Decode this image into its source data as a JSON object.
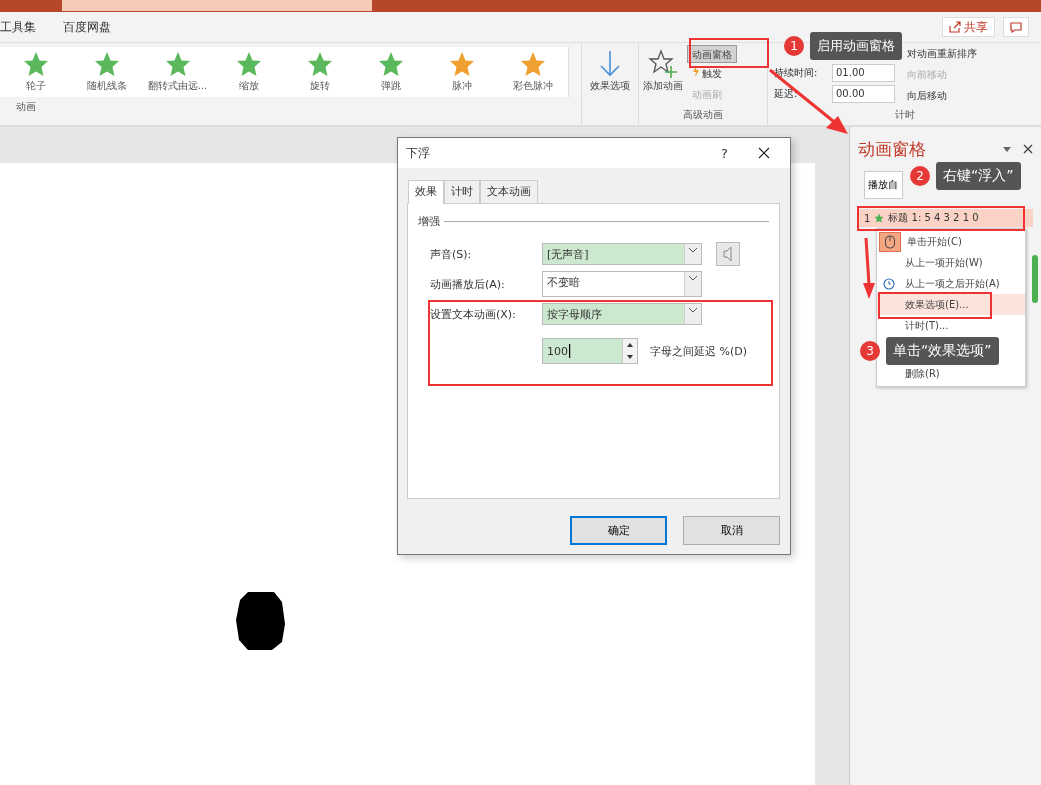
{
  "menu_tabs": [
    {
      "label": "工具集",
      "selected": false
    },
    {
      "label": "百度网盘",
      "selected": false
    }
  ],
  "share_button": "共享",
  "ribbon": {
    "gallery": [
      {
        "label": "轮子",
        "color": "#5cb85c"
      },
      {
        "label": "随机线条",
        "color": "#5cb85c"
      },
      {
        "label": "翻转式由远...",
        "color": "#5cb85c"
      },
      {
        "label": "缩放",
        "color": "#5cb85c"
      },
      {
        "label": "旋转",
        "color": "#5cb85c"
      },
      {
        "label": "弹跳",
        "color": "#5cb85c"
      },
      {
        "label": "脉冲",
        "color": "#f0a030"
      },
      {
        "label": "彩色脉冲",
        "color": "#f0a030"
      }
    ],
    "animation_group": "动画",
    "effect_options": "效果选项",
    "add_animation": "添加动画",
    "animation_pane": {
      "label": "动画窗格",
      "selected": true
    },
    "trigger": "触发",
    "painter": {
      "label": "动画刷",
      "disabled": true
    },
    "advanced_group": "高级动画",
    "duration_label": "持续时间:",
    "duration": "01.00",
    "delay_label": "延迟:",
    "delay": "00.00",
    "reorder": "对动画重新排序",
    "move_earlier": {
      "label": "向前移动",
      "disabled": true
    },
    "move_later": {
      "label": "向后移动",
      "disabled": false
    },
    "timing_group": "计时"
  },
  "pane": {
    "title": "动画窗格",
    "play_button": "播放自",
    "item": {
      "number": "1",
      "label": "标题 1: 5 4 3 2 1 0",
      "selected": true
    },
    "menu": [
      {
        "label": "单击开始(C)",
        "kind": "mouse",
        "checked": true,
        "selected": false
      },
      {
        "label": "从上一项开始(W)",
        "kind": "plain",
        "checked": false,
        "selected": false
      },
      {
        "label": "从上一项之后开始(A)",
        "kind": "clock",
        "checked": false,
        "selected": false
      },
      {
        "label": "效果选项(E)...",
        "kind": "plain",
        "checked": false,
        "selected": true
      },
      {
        "label": "计时(T)...",
        "kind": "plain",
        "checked": false,
        "selected": false
      },
      {
        "label": "删除(R)",
        "kind": "plain",
        "checked": false,
        "selected": false
      }
    ]
  },
  "dialog": {
    "title": "下浮",
    "help": "?",
    "tabs": [
      {
        "label": "效果",
        "selected": true
      },
      {
        "label": "计时",
        "selected": false
      },
      {
        "label": "文本动画",
        "selected": false
      }
    ],
    "group": "增强",
    "sound": {
      "label": "声音(S):",
      "value": "[无声音]"
    },
    "after": {
      "label": "动画播放后(A):",
      "value": "不变暗"
    },
    "text_anim": {
      "label": "设置文本动画(X):",
      "value": "按字母顺序"
    },
    "delay": {
      "value": "100",
      "label": "字母之间延迟 %(D)"
    },
    "buttons": [
      {
        "label": "确定",
        "selected": true
      },
      {
        "label": "取消",
        "selected": false
      }
    ]
  },
  "callouts": [
    {
      "number": "1",
      "text": "启用动画窗格"
    },
    {
      "number": "2",
      "text": "右键“浮入”"
    },
    {
      "number": "3",
      "text": "单击“效果选项”"
    }
  ]
}
